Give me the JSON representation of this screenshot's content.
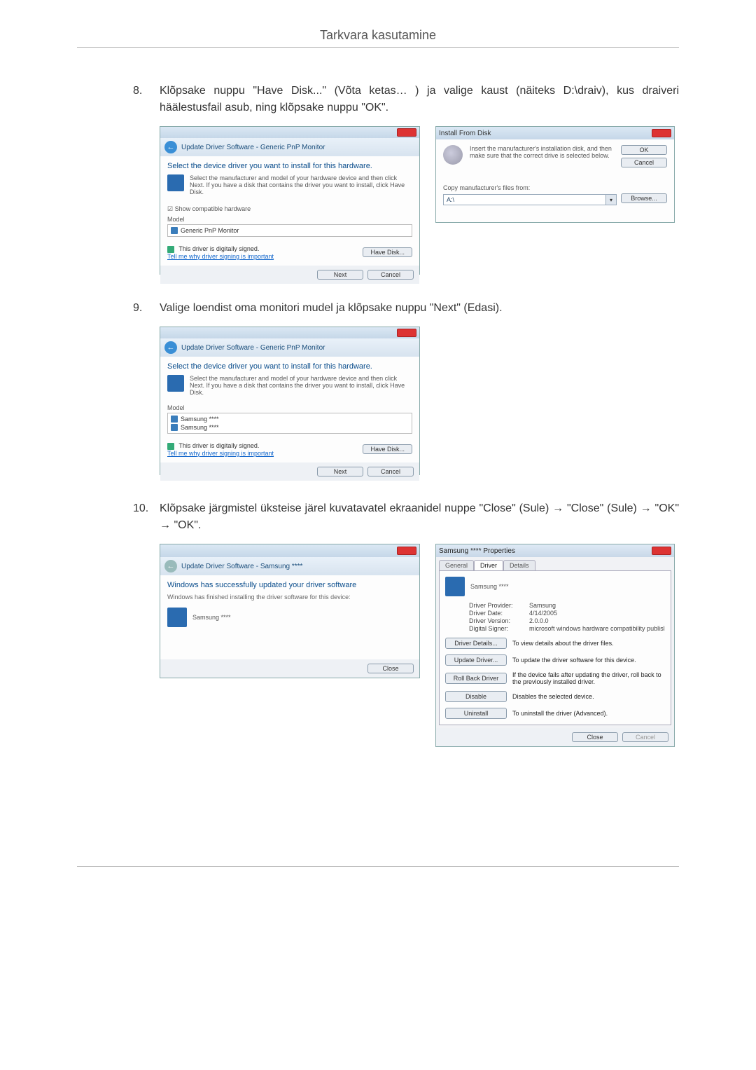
{
  "page_title": "Tarkvara kasutamine",
  "steps": {
    "s8": {
      "num": "8.",
      "text": "Klõpsake nuppu \"Have Disk...\" (Võta ketas… ) ja valige kaust (näiteks D:\\draiv), kus draiveri häälestusfail asub, ning klõpsake nuppu \"OK\"."
    },
    "s9": {
      "num": "9.",
      "text": "Valige loendist oma monitori mudel ja klõpsake nuppu \"Next\" (Edasi)."
    },
    "s10": {
      "num": "10.",
      "text": "Klõpsake järgmistel üksteise järel kuvatavatel ekraanidel nuppe \"Close\" (Sule) → \"Close\" (Sule) → \"OK\" → \"OK\"."
    }
  },
  "dialog_update": {
    "breadcrumb": "Update Driver Software - Generic PnP Monitor",
    "heading": "Select the device driver you want to install for this hardware.",
    "hint": "Select the manufacturer and model of your hardware device and then click Next. If you have a disk that contains the driver you want to install, click Have Disk.",
    "show_compat": "Show compatible hardware",
    "model_label": "Model",
    "model_item": "Generic PnP Monitor",
    "signed": "This driver is digitally signed.",
    "tell_me": "Tell me why driver signing is important",
    "have_disk": "Have Disk...",
    "next": "Next",
    "cancel": "Cancel"
  },
  "dialog_ifd": {
    "title": "Install From Disk",
    "hint": "Insert the manufacturer's installation disk, and then make sure that the correct drive is selected below.",
    "copy_label": "Copy manufacturer's files from:",
    "combo_value": "A:\\",
    "ok": "OK",
    "cancel": "Cancel",
    "browse": "Browse..."
  },
  "dialog_update2": {
    "breadcrumb": "Update Driver Software - Generic PnP Monitor",
    "heading": "Select the device driver you want to install for this hardware.",
    "hint": "Select the manufacturer and model of your hardware device and then click Next. If you have a disk that contains the driver you want to install, click Have Disk.",
    "model_label": "Model",
    "model_item1": "Samsung ****",
    "model_item2": "Samsung ****",
    "signed": "This driver is digitally signed.",
    "tell_me": "Tell me why driver signing is important",
    "have_disk": "Have Disk...",
    "next": "Next",
    "cancel": "Cancel"
  },
  "dialog_done": {
    "breadcrumb": "Update Driver Software - Samsung ****",
    "heading": "Windows has successfully updated your driver software",
    "sub": "Windows has finished installing the driver software for this device:",
    "device": "Samsung ****",
    "close": "Close"
  },
  "dialog_props": {
    "title": "Samsung **** Properties",
    "tab_general": "General",
    "tab_driver": "Driver",
    "tab_details": "Details",
    "device_name": "Samsung ****",
    "kv_provider_k": "Driver Provider:",
    "kv_provider_v": "Samsung",
    "kv_date_k": "Driver Date:",
    "kv_date_v": "4/14/2005",
    "kv_version_k": "Driver Version:",
    "kv_version_v": "2.0.0.0",
    "kv_signer_k": "Digital Signer:",
    "kv_signer_v": "microsoft windows hardware compatibility publisl",
    "btn_details": "Driver Details...",
    "btn_details_d": "To view details about the driver files.",
    "btn_update": "Update Driver...",
    "btn_update_d": "To update the driver software for this device.",
    "btn_rollback": "Roll Back Driver",
    "btn_rollback_d": "If the device fails after updating the driver, roll back to the previously installed driver.",
    "btn_disable": "Disable",
    "btn_disable_d": "Disables the selected device.",
    "btn_uninstall": "Uninstall",
    "btn_uninstall_d": "To uninstall the driver (Advanced).",
    "close": "Close",
    "cancel": "Cancel"
  }
}
